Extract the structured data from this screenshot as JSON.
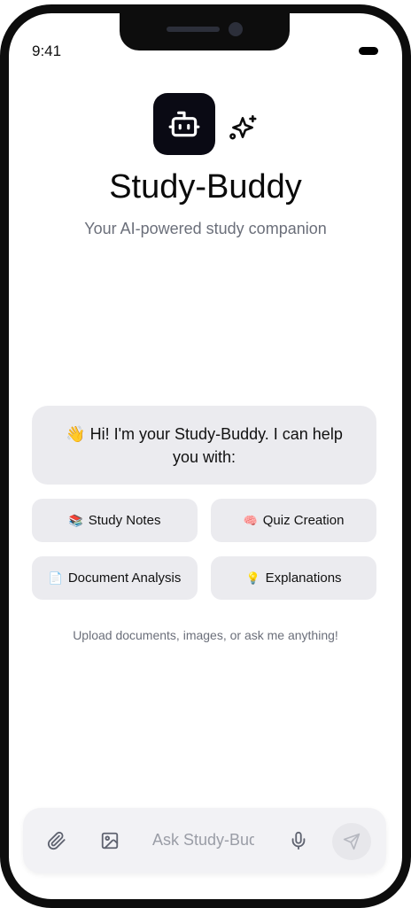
{
  "status_bar": {
    "time": "9:41"
  },
  "header": {
    "title": "Study-Buddy",
    "subtitle": "Your AI-powered study companion",
    "logo_icon": "robot-icon",
    "sparkle_icon": "sparkles-icon"
  },
  "welcome": {
    "emoji": "👋",
    "message": "Hi! I'm your Study-Buddy. I can help you with:"
  },
  "features": [
    {
      "emoji": "📚",
      "label": "Study Notes"
    },
    {
      "emoji": "🧠",
      "label": "Quiz Creation"
    },
    {
      "emoji": "📄",
      "label": "Document Analysis"
    },
    {
      "emoji": "💡",
      "label": "Explanations"
    }
  ],
  "hint": "Upload documents, images, or ask me anything!",
  "composer": {
    "placeholder": "Ask Study-Buddy...",
    "icons": [
      "paperclip-icon",
      "image-icon",
      "microphone-icon",
      "send-icon"
    ]
  },
  "colors": {
    "logo_bg": "#0a0a14",
    "bubble_bg": "#ebebef",
    "muted_text": "#6b6f7a"
  }
}
